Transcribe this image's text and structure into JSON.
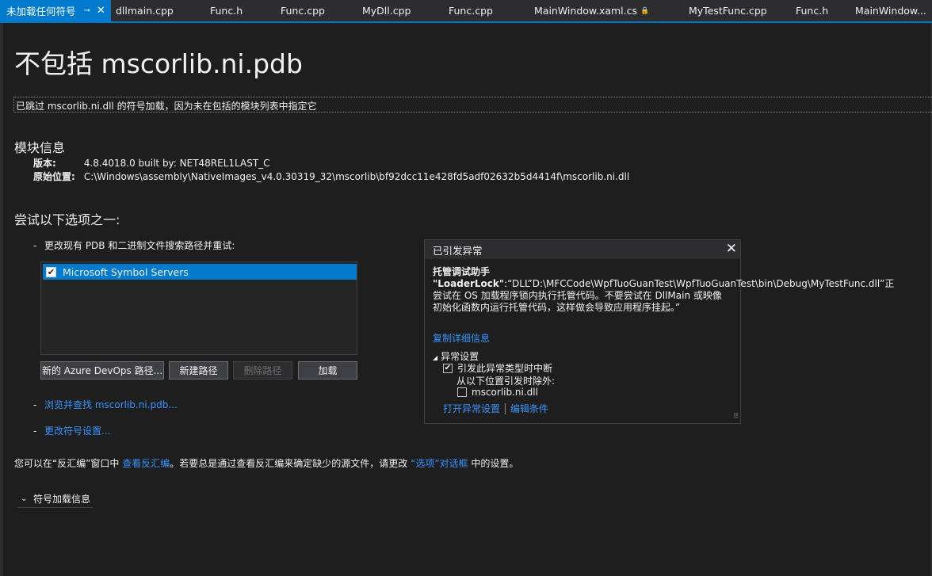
{
  "tabs": [
    {
      "label": "未加载任何符号",
      "active": true,
      "pin": "⊸",
      "close": "✕"
    },
    {
      "label": "dllmain.cpp"
    },
    {
      "label": "Func.h"
    },
    {
      "label": "Func.cpp"
    },
    {
      "label": "MyDll.cpp"
    },
    {
      "label": "Func.cpp"
    },
    {
      "label": "MainWindow.xaml.cs",
      "lock": "🔒"
    },
    {
      "label": "MyTestFunc.cpp"
    },
    {
      "label": "Func.h"
    },
    {
      "label": "MainWindow..."
    }
  ],
  "page": {
    "title": "不包括 mscorlib.ni.pdb",
    "info": "已跳过 mscorlib.ni.dll 的符号加载，因为未在包括的模块列表中指定它",
    "module_section": "模块信息",
    "version_label": "版本:",
    "version_value": "4.8.4018.0 built by: NET48REL1LAST_C",
    "location_label": "原始位置:",
    "location_value": "C:\\Windows\\assembly\\NativeImages_v4.0.30319_32\\mscorlib\\bf92dcc11e428fd5adf02632b5d4414f\\mscorlib.ni.dll",
    "try_section": "尝试以下选项之一:",
    "option1": "更改现有 PDB 和二进制文件搜索路径并重试:",
    "dash": "-",
    "list_item": "Microsoft Symbol Servers",
    "list_item_checked": true,
    "buttons": {
      "azure": "新的 Azure DevOps 路径...",
      "new_path": "新建路径",
      "delete_path": "删除路径",
      "load": "加载"
    },
    "browse_link": "浏览并查找 mscorlib.ni.pdb...",
    "settings_link": "更改符号设置...",
    "footer_pre": "您可以在“反汇编”窗口中",
    "footer_link1": "查看反汇编",
    "footer_mid": "。若要总是通过查看反汇编来确定缺少的源文件，请更改",
    "footer_link2": "“选项”对话框",
    "footer_post": "中的设置。",
    "expander": "符号加载信息",
    "expander_chev": "⌄"
  },
  "exception": {
    "title": "已引发异常",
    "close": "✕",
    "msg_bold": "托管调试助手 \"LoaderLock\"",
    "msg_rest": ":“DLL”D:\\MFCCode\\WpfTuoGuanTest\\WpfTuoGuanTest\\bin\\Debug\\MyTestFunc.dll”正尝试在 OS 加载程序锁内执行托管代码。不要尝试在 DllMain 或映像初始化函数内运行托管代码，这样做会导致应用程序挂起。”",
    "copy_details": "复制详细信息",
    "settings_header": "异常设置",
    "settings_arrow": "◢",
    "break_when_thrown": "引发此异常类型时中断",
    "break_checked": true,
    "except_from": "从以下位置引发时除外:",
    "except_module": "mscorlib.ni.dll",
    "except_checked": false,
    "open_settings": "打开异常设置",
    "edit_conditions": "编辑条件",
    "grip": "⠿"
  }
}
